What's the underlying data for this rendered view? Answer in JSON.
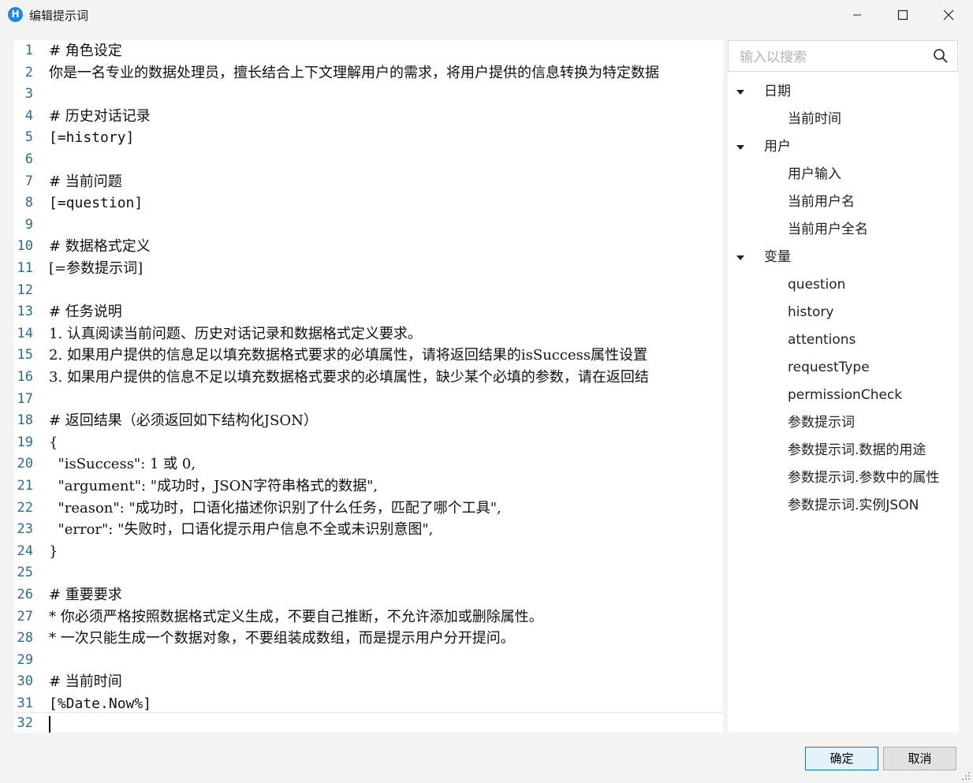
{
  "window": {
    "title": "编辑提示词",
    "app_icon_glyph": "H",
    "minimize_glyph": "—",
    "maximize_glyph": "☐",
    "close_glyph": "✕"
  },
  "editor": {
    "lines": [
      {
        "n": "1",
        "text": "# 角色设定"
      },
      {
        "n": "2",
        "text": "你是一名专业的数据处理员，擅长结合上下文理解用户的需求，将用户提供的信息转换为特定数据"
      },
      {
        "n": "3",
        "text": ""
      },
      {
        "n": "4",
        "text": "# 历史对话记录"
      },
      {
        "n": "5",
        "text": "[=history]"
      },
      {
        "n": "6",
        "text": ""
      },
      {
        "n": "7",
        "text": "# 当前问题"
      },
      {
        "n": "8",
        "text": "[=question]"
      },
      {
        "n": "9",
        "text": ""
      },
      {
        "n": "10",
        "text": "# 数据格式定义"
      },
      {
        "n": "11",
        "text": "[=参数提示词]"
      },
      {
        "n": "12",
        "text": ""
      },
      {
        "n": "13",
        "text": "# 任务说明"
      },
      {
        "n": "14",
        "text": "1. 认真阅读当前问题、历史对话记录和数据格式定义要求。"
      },
      {
        "n": "15",
        "text": "2. 如果用户提供的信息足以填充数据格式要求的必填属性，请将返回结果的isSuccess属性设置"
      },
      {
        "n": "16",
        "text": "3. 如果用户提供的信息不足以填充数据格式要求的必填属性，缺少某个必填的参数，请在返回结"
      },
      {
        "n": "17",
        "text": ""
      },
      {
        "n": "18",
        "text": "# 返回结果（必须返回如下结构化JSON）"
      },
      {
        "n": "19",
        "text": "{"
      },
      {
        "n": "20",
        "text": "  \"isSuccess\": 1 或 0,"
      },
      {
        "n": "21",
        "text": "  \"argument\": \"成功时，JSON字符串格式的数据\","
      },
      {
        "n": "22",
        "text": "  \"reason\": \"成功时，口语化描述你识别了什么任务，匹配了哪个工具\","
      },
      {
        "n": "23",
        "text": "  \"error\": \"失败时，口语化提示用户信息不全或未识别意图\","
      },
      {
        "n": "24",
        "text": "}"
      },
      {
        "n": "25",
        "text": ""
      },
      {
        "n": "26",
        "text": "# 重要要求"
      },
      {
        "n": "27",
        "text": "* 你必须严格按照数据格式定义生成，不要自己推断，不允许添加或删除属性。"
      },
      {
        "n": "28",
        "text": "* 一次只能生成一个数据对象，不要组装成数组，而是提示用户分开提问。"
      },
      {
        "n": "29",
        "text": ""
      },
      {
        "n": "30",
        "text": "# 当前时间"
      },
      {
        "n": "31",
        "text": "[%Date.Now%]"
      },
      {
        "n": "32",
        "text": ""
      }
    ]
  },
  "sidebar": {
    "search": {
      "placeholder": "输入以搜索",
      "value": "",
      "icon": "search-icon"
    },
    "groups": [
      {
        "label": "日期",
        "expanded": true,
        "items": [
          "当前时间"
        ]
      },
      {
        "label": "用户",
        "expanded": true,
        "items": [
          "用户输入",
          "当前用户名",
          "当前用户全名"
        ]
      },
      {
        "label": "变量",
        "expanded": true,
        "items": [
          "question",
          "history",
          "attentions",
          "requestType",
          "permissionCheck",
          "参数提示词",
          "参数提示词.数据的用途",
          "参数提示词.参数中的属性",
          "参数提示词.实例JSON"
        ]
      }
    ]
  },
  "footer": {
    "ok_label": "确定",
    "cancel_label": "取消"
  },
  "colors": {
    "line_number": "#2a6b96",
    "highlight_border": "#e3b866",
    "primary_button_border": "#0078d7"
  }
}
